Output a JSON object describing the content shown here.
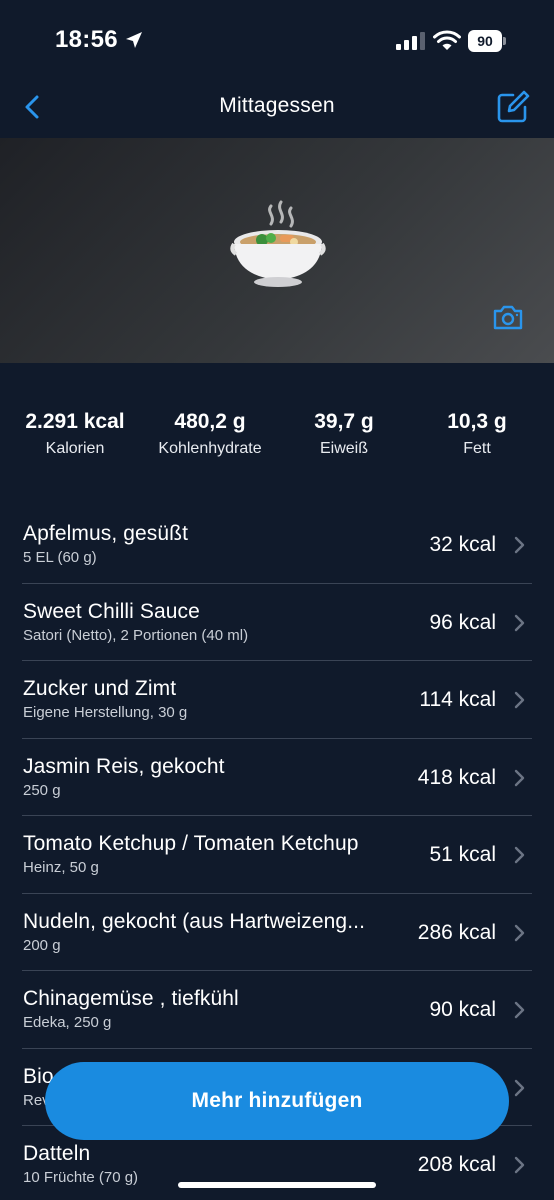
{
  "status_bar": {
    "time": "18:56",
    "battery": "90"
  },
  "nav": {
    "title": "Mittagessen"
  },
  "summary": [
    {
      "value": "2.291 kcal",
      "label": "Kalorien"
    },
    {
      "value": "480,2 g",
      "label": "Kohlenhydrate"
    },
    {
      "value": "39,7 g",
      "label": "Eiweiß"
    },
    {
      "value": "10,3 g",
      "label": "Fett"
    }
  ],
  "foods": [
    {
      "name": "Apfelmus, gesüßt",
      "detail": "5 EL (60 g)",
      "kcal": "32 kcal"
    },
    {
      "name": "Sweet Chilli Sauce",
      "detail": "Satori (Netto), 2 Portionen (40 ml)",
      "kcal": "96 kcal"
    },
    {
      "name": "Zucker und Zimt",
      "detail": "Eigene Herstellung, 30 g",
      "kcal": "114 kcal"
    },
    {
      "name": "Jasmin Reis, gekocht",
      "detail": "250 g",
      "kcal": "418 kcal"
    },
    {
      "name": "Tomato Ketchup / Tomaten Ketchup",
      "detail": "Heinz, 50 g",
      "kcal": "51 kcal"
    },
    {
      "name": "Nudeln, gekocht (aus Hartweizeng...",
      "detail": "200 g",
      "kcal": "286 kcal"
    },
    {
      "name": "Chinagemüse , tiefkühl",
      "detail": "Edeka, 250 g",
      "kcal": "90 kcal"
    },
    {
      "name": "Bio",
      "detail": "Rev",
      "kcal": ""
    },
    {
      "name": "Datteln",
      "detail": "10 Früchte (70 g)",
      "kcal": "208 kcal"
    }
  ],
  "add_button_label": "Mehr hinzufügen",
  "colors": {
    "background": "#101a2b",
    "accent": "#1a8be0",
    "divider": "#3a4455"
  },
  "icons": [
    "back-chevron-icon",
    "edit-icon",
    "camera-icon",
    "chevron-right-icon",
    "location-arrow-icon",
    "signal-icon",
    "wifi-icon",
    "battery-icon",
    "soup-bowl-icon"
  ]
}
